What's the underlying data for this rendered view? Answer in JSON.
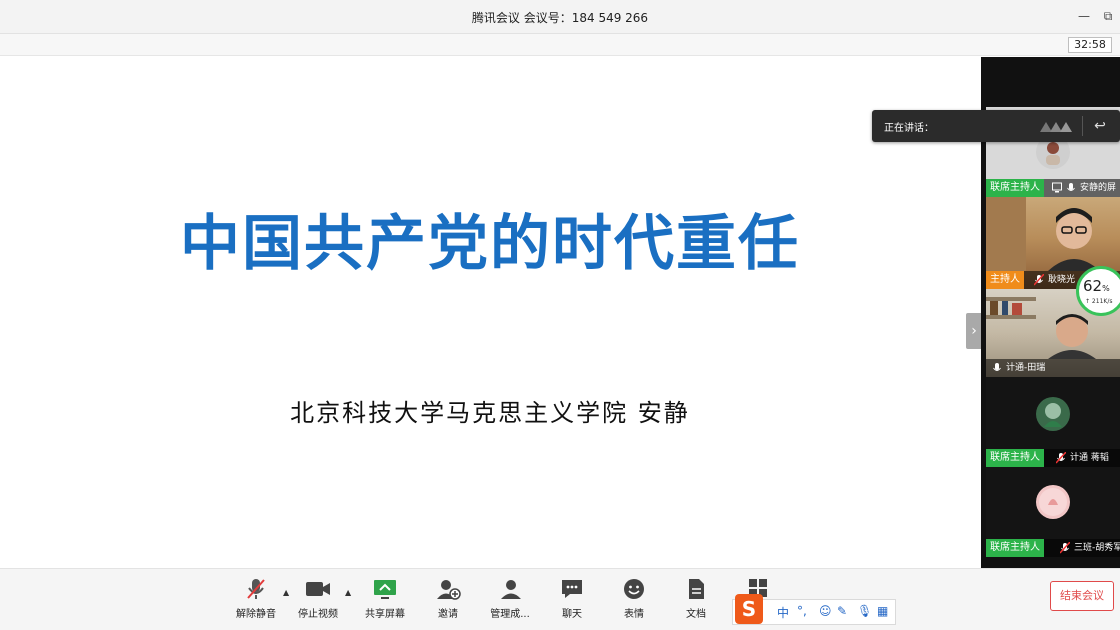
{
  "window": {
    "title": "腾讯会议 会议号：184 549 266",
    "minimize_glyph": "—",
    "restore_glyph": "⧉"
  },
  "meeting": {
    "elapsed_time": "32:58"
  },
  "slide": {
    "title": "中国共产党的时代重任",
    "subtitle": "北京科技大学马克思主义学院  安静"
  },
  "speaking_popup": {
    "label": "正在讲话：",
    "reply_icon": "reply-icon"
  },
  "network": {
    "percent": "62",
    "percent_unit": "%",
    "rate": "↑ 211K/s"
  },
  "participants": [
    {
      "role": "联席主持人",
      "name": "安静的屏",
      "role_color": "#2cb34a",
      "muted": false,
      "has_screen_icon": true
    },
    {
      "role": "主持人",
      "name": "耿晓光",
      "role_color": "#f08c1a",
      "muted": true
    },
    {
      "role": "",
      "name": "计通-田瑞",
      "muted": false
    },
    {
      "role": "联席主持人",
      "name": "计通 蒋韬",
      "role_color": "#2cb34a",
      "muted": true
    },
    {
      "role": "联席主持人",
      "name": "三班-胡秀军",
      "role_color": "#2cb34a",
      "muted": true
    }
  ],
  "toolbar": {
    "unmute": "解除静音",
    "stop_video": "停止视频",
    "share_screen": "共享屏幕",
    "invite": "邀请",
    "manage_members": "管理成...",
    "chat": "聊天",
    "reactions": "表情",
    "documents": "文档",
    "end_meeting": "结束会议"
  },
  "ime": {
    "logo": "S",
    "mode": "中",
    "punct": "°,"
  },
  "colors": {
    "slide_title": "#1a6fc2",
    "cohost_badge": "#2cb34a",
    "host_badge": "#f08c1a",
    "end_button": "#e04a4a",
    "gauge": "#39c35a"
  }
}
